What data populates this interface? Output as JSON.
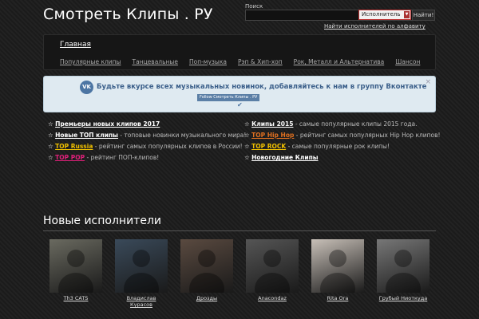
{
  "header": {
    "site_title": "Смотреть Клипы . РУ",
    "search_label": "Поиск",
    "search_select": "Исполнитель",
    "search_button": "Найти!",
    "alphabet_link": "Найти исполнителей по алфавиту"
  },
  "nav": {
    "home": "Главная",
    "links": [
      "Популярные клипы",
      "Танцевальные",
      "Поп-музыка",
      "Рэп & Хип-хоп",
      "Рок, Металл и Альтернатива",
      "Шансон"
    ]
  },
  "vk_banner": {
    "logo": "VK",
    "text": "Будьте вкурсе всех музыкальных новинок, добавляйтесь к нам в группу Вконтакте",
    "follow_label": "Follow Смотреть Клипы . РУ",
    "check": "✔",
    "close": "×"
  },
  "promos_left": [
    {
      "link": "Премьеры новых клипов 2017",
      "desc": "",
      "color": "#ffffff"
    },
    {
      "link": "Новые ТОП клипы",
      "desc": " - топовые новинки музыкального мира!",
      "color": "#ffffff"
    },
    {
      "link": "TOP Russia",
      "desc": " - рейтинг самых популярных клипов в России!",
      "color": "#f0c000"
    },
    {
      "link": "TOP POP",
      "desc": " - рейтинг ПОП-клипов!",
      "color": "#e0207a"
    }
  ],
  "promos_right": [
    {
      "link": "Клипы 2015",
      "desc": " - самые популярные клипы 2015 года.",
      "color": "#ffffff"
    },
    {
      "link": "TOP Hip Hop",
      "desc": " - рейтинг самых популярных Hip Hop клипов!",
      "color": "#e07020"
    },
    {
      "link": "TOP ROCK",
      "desc": " - самые популярные рок клипы!",
      "color": "#f0c000"
    },
    {
      "link": "Новогодние Клипы",
      "desc": "",
      "color": "#ffffff"
    }
  ],
  "new_artists": {
    "title": "Новые исполнители",
    "items": [
      {
        "name": "Th3 CATS",
        "bg": "#6a6a60"
      },
      {
        "name": "Владислав Курасов",
        "bg": "#3a4a5a"
      },
      {
        "name": "Дрозды",
        "bg": "#5a4a40"
      },
      {
        "name": "Anacondaz",
        "bg": "#555555"
      },
      {
        "name": "Rita Ora",
        "bg": "#c8c0b8"
      },
      {
        "name": "Грубый Ниоткуда",
        "bg": "#777777"
      }
    ]
  }
}
